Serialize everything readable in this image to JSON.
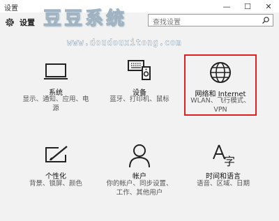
{
  "window": {
    "title": "设置",
    "minimize": "—",
    "maximize": "☐",
    "close": "✕"
  },
  "header": {
    "app_title": "设置",
    "search_placeholder": "查找设置"
  },
  "watermark": {
    "title": "豆豆系统",
    "url": "www.doudouxitong.com"
  },
  "tiles": [
    {
      "name": "系统",
      "desc1": "显示、通知、应用、电",
      "desc2": "源",
      "icon": "monitor-icon"
    },
    {
      "name": "设备",
      "desc1": "蓝牙、打印机、鼠标",
      "desc2": "",
      "icon": "devices-icon"
    },
    {
      "name": "网络和 Internet",
      "desc1": "WLAN、飞行模式、",
      "desc2": "VPN",
      "icon": "globe-icon",
      "selected": true
    },
    {
      "name": "个性化",
      "desc1": "背景、锁屏、颜色",
      "desc2": "",
      "icon": "personalization-icon"
    },
    {
      "name": "帐户",
      "desc1": "你的帐户、同步设置、",
      "desc2": "工作、其他用户",
      "icon": "person-icon"
    },
    {
      "name": "时间和语言",
      "desc1": "语音、区域、日期",
      "desc2": "",
      "icon": "time-language-icon"
    }
  ],
  "colors": {
    "selection_border": "#e02020",
    "background": "#f2f2f2"
  }
}
